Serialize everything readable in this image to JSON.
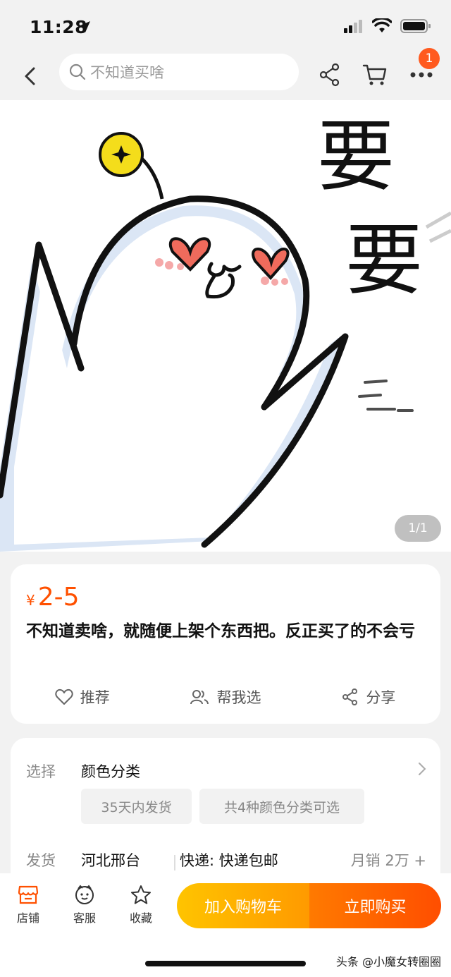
{
  "status": {
    "time": "11:28"
  },
  "nav": {
    "search_placeholder": "不知道买啥",
    "cart_badge": "1"
  },
  "hero": {
    "pager": "1/1",
    "caption_chars": [
      "要",
      "要"
    ]
  },
  "product": {
    "currency": "¥",
    "price": "2-5",
    "title": "不知道卖啥，就随便上架个东西把。反正买了的不会亏",
    "actions": [
      {
        "label": "推荐",
        "icon": "heart-icon"
      },
      {
        "label": "帮我选",
        "icon": "people-icon"
      },
      {
        "label": "分享",
        "icon": "share-icon"
      }
    ]
  },
  "options": {
    "select_label": "选择",
    "select_value": "颜色分类",
    "chip1": "35天内发货",
    "chip2": "共4种颜色分类可选",
    "ship_label": "发货",
    "ship_from": "河北邢台",
    "ship_method": "快递: 快递包邮",
    "monthly_sales": "月销 2万 +"
  },
  "bottom": {
    "tabs": [
      {
        "label": "店铺",
        "icon": "store-icon"
      },
      {
        "label": "客服",
        "icon": "service-icon"
      },
      {
        "label": "收藏",
        "icon": "star-icon"
      }
    ],
    "add_to_cart": "加入购物车",
    "buy_now": "立即购买",
    "watermark": "头条 @小魔女转圈圈"
  },
  "colors": {
    "accent": "#ff5000",
    "cart_gradient": "#ffc400",
    "buy_gradient": "#ff4e00"
  }
}
